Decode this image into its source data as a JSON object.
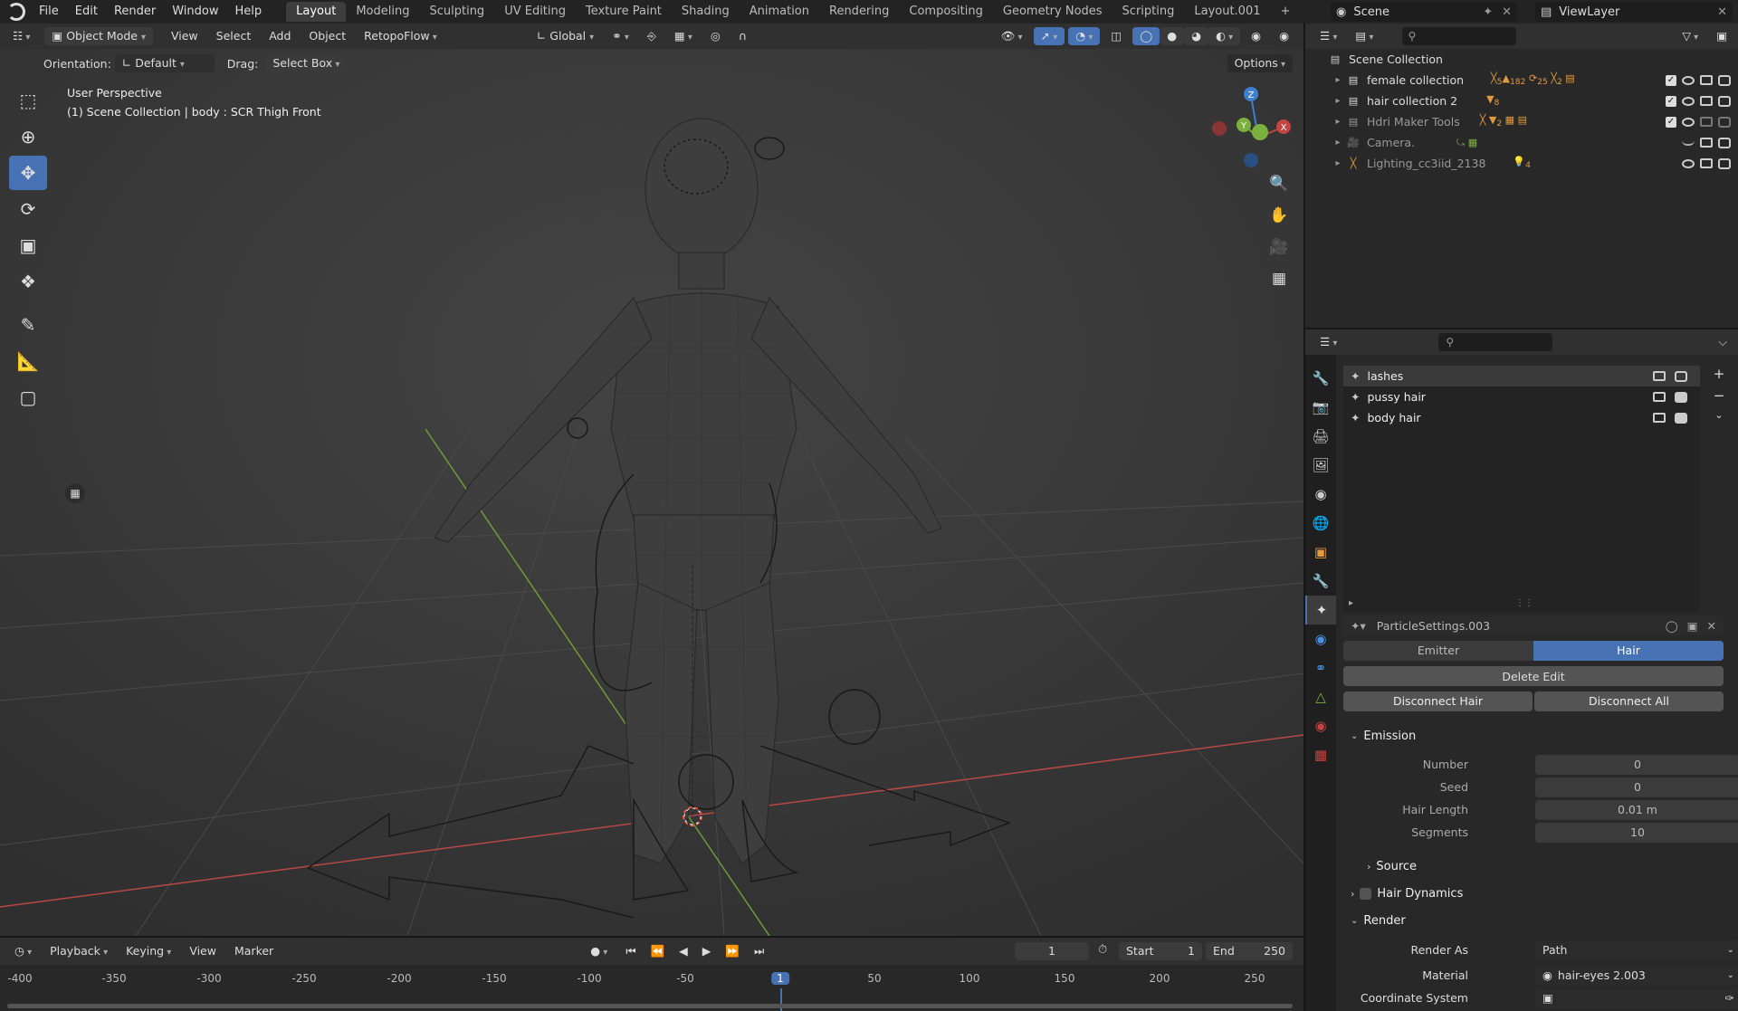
{
  "menu": {
    "items": [
      "File",
      "Edit",
      "Render",
      "Window",
      "Help"
    ]
  },
  "workspaces": [
    "Layout",
    "Modeling",
    "Sculpting",
    "UV Editing",
    "Texture Paint",
    "Shading",
    "Animation",
    "Rendering",
    "Compositing",
    "Geometry Nodes",
    "Scripting",
    "Layout.001"
  ],
  "scene": {
    "name": "Scene",
    "view_layer": "ViewLayer"
  },
  "viewport_header": {
    "mode": "Object Mode",
    "view": "View",
    "select": "Select",
    "add": "Add",
    "object": "Object",
    "addon": "RetopoFlow",
    "transform": "Global",
    "orientation_label": "Orientation:",
    "orientation_value": "Default",
    "drag_label": "Drag:",
    "drag_value": "Select Box",
    "options": "Options"
  },
  "viewport": {
    "perspective": "User Perspective",
    "info": "(1) Scene Collection | body  : SCR Thigh Front",
    "axes": {
      "x": "X",
      "y": "Y",
      "z": "Z"
    }
  },
  "outliner": {
    "root": "Scene Collection",
    "rows": [
      {
        "label": "female collection",
        "badges": [
          "5",
          "182",
          "25",
          "2"
        ]
      },
      {
        "label": "hair collection 2",
        "badges": [
          "8"
        ]
      },
      {
        "label": "Hdri Maker Tools",
        "badges": [
          "2"
        ]
      },
      {
        "label": "Camera.",
        "badges": []
      },
      {
        "label": "Lighting_cc3iid_2138",
        "badges": [
          "4"
        ]
      }
    ]
  },
  "particles": {
    "list": [
      "lashes",
      "pussy hair",
      "body hair"
    ],
    "settings_name": "ParticleSettings.003",
    "type_options": [
      "Emitter",
      "Hair"
    ],
    "type_selected": "Hair",
    "delete_edit": "Delete Edit",
    "disconnect_hair": "Disconnect Hair",
    "disconnect_all": "Disconnect All",
    "emission": {
      "title": "Emission",
      "number_label": "Number",
      "number": "0",
      "seed_label": "Seed",
      "seed": "0",
      "hair_length_label": "Hair Length",
      "hair_length": "0.01 m",
      "segments_label": "Segments",
      "segments": "10"
    },
    "source": "Source",
    "hair_dynamics": "Hair Dynamics",
    "render": {
      "title": "Render",
      "render_as_label": "Render As",
      "render_as": "Path",
      "material_label": "Material",
      "material": "hair-eyes 2.003",
      "coord_label": "Coordinate System"
    }
  },
  "timeline": {
    "playback": "Playback",
    "keying": "Keying",
    "view": "View",
    "marker": "Marker",
    "current_frame": "1",
    "start_label": "Start",
    "start": "1",
    "end_label": "End",
    "end": "250",
    "ruler": [
      "-400",
      "-350",
      "-300",
      "-250",
      "-200",
      "-150",
      "-100",
      "-50",
      "1",
      "50",
      "100",
      "150",
      "200",
      "250"
    ]
  },
  "colors": {
    "accent": "#4772b3",
    "x_axis": "#c44444",
    "y_axis": "#7ab13e",
    "z_axis": "#3f7fd0"
  }
}
